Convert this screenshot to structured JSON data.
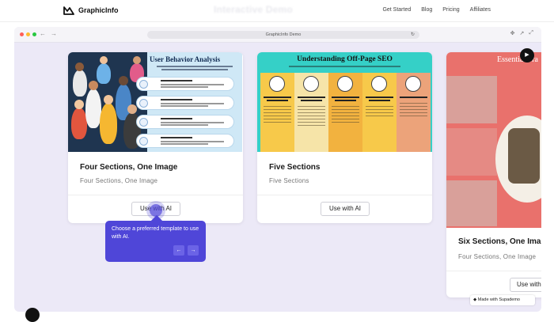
{
  "nav": {
    "brand": "GraphicInfo",
    "ghost_title": "Interactive Demo",
    "links": [
      "Get Started",
      "Blog",
      "Pricing",
      "Affiliates"
    ]
  },
  "browser": {
    "url": "GraphicInfo Demo"
  },
  "cards": [
    {
      "image_title": "User Behavior Analysis",
      "title": "Four Sections, One Image",
      "subtitle": "Four Sections, One Image",
      "button": "Use with AI"
    },
    {
      "image_title": "Understanding Off-Page SEO",
      "title": "Five Sections",
      "subtitle": "Five Sections",
      "button": "Use with AI"
    },
    {
      "image_title": "Essential Tra",
      "title": "Six Sections, One Image",
      "subtitle": "Four Sections, One Image",
      "button": "Use with"
    }
  ],
  "tooltip": {
    "text": "Choose a preferred template to use with AI.",
    "prev_icon": "arrow-left-icon",
    "next_icon": "arrow-right-icon"
  },
  "badge": {
    "made_with": "Made with Supademo"
  },
  "colors": {
    "accent": "#4f46d8",
    "browser_bg": "#ece9f7",
    "card2_teal": "#35d0c7",
    "card3_coral": "#e9716c"
  }
}
